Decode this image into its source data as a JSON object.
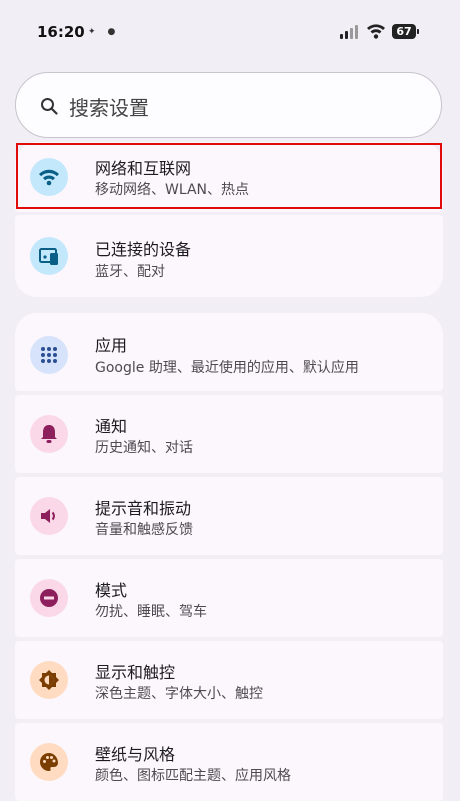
{
  "status_bar": {
    "time": "16:20",
    "battery": "67"
  },
  "search": {
    "placeholder": "搜索设置"
  },
  "items": [
    {
      "title": "网络和互联网",
      "subtitle": "移动网络、WLAN、热点",
      "icon": "wifi-icon",
      "color": "#0a5f86",
      "bg": "#c3e8fb"
    },
    {
      "title": "已连接的设备",
      "subtitle": "蓝牙、配对",
      "icon": "connected-devices-icon",
      "color": "#0a5f86",
      "bg": "#c3e8fb"
    },
    {
      "title": "应用",
      "subtitle": "Google 助理、最近使用的应用、默认应用",
      "icon": "apps-grid-icon",
      "color": "#2b4f92",
      "bg": "#d6e3fb"
    },
    {
      "title": "通知",
      "subtitle": "历史通知、对话",
      "icon": "bell-icon",
      "color": "#8c1f5c",
      "bg": "#fbd8e8"
    },
    {
      "title": "提示音和振动",
      "subtitle": "音量和触感反馈",
      "icon": "volume-icon",
      "color": "#8c1f5c",
      "bg": "#fbd8e8"
    },
    {
      "title": "模式",
      "subtitle": "勿扰、睡眠、驾车",
      "icon": "dnd-mode-icon",
      "color": "#8c1f5c",
      "bg": "#fbd8e8"
    },
    {
      "title": "显示和触控",
      "subtitle": "深色主题、字体大小、触控",
      "icon": "brightness-icon",
      "color": "#7a3e00",
      "bg": "#ffdcc1"
    },
    {
      "title": "壁纸与风格",
      "subtitle": "颜色、图标匹配主题、应用风格",
      "icon": "palette-icon",
      "color": "#7a3e00",
      "bg": "#ffdcc1"
    }
  ]
}
